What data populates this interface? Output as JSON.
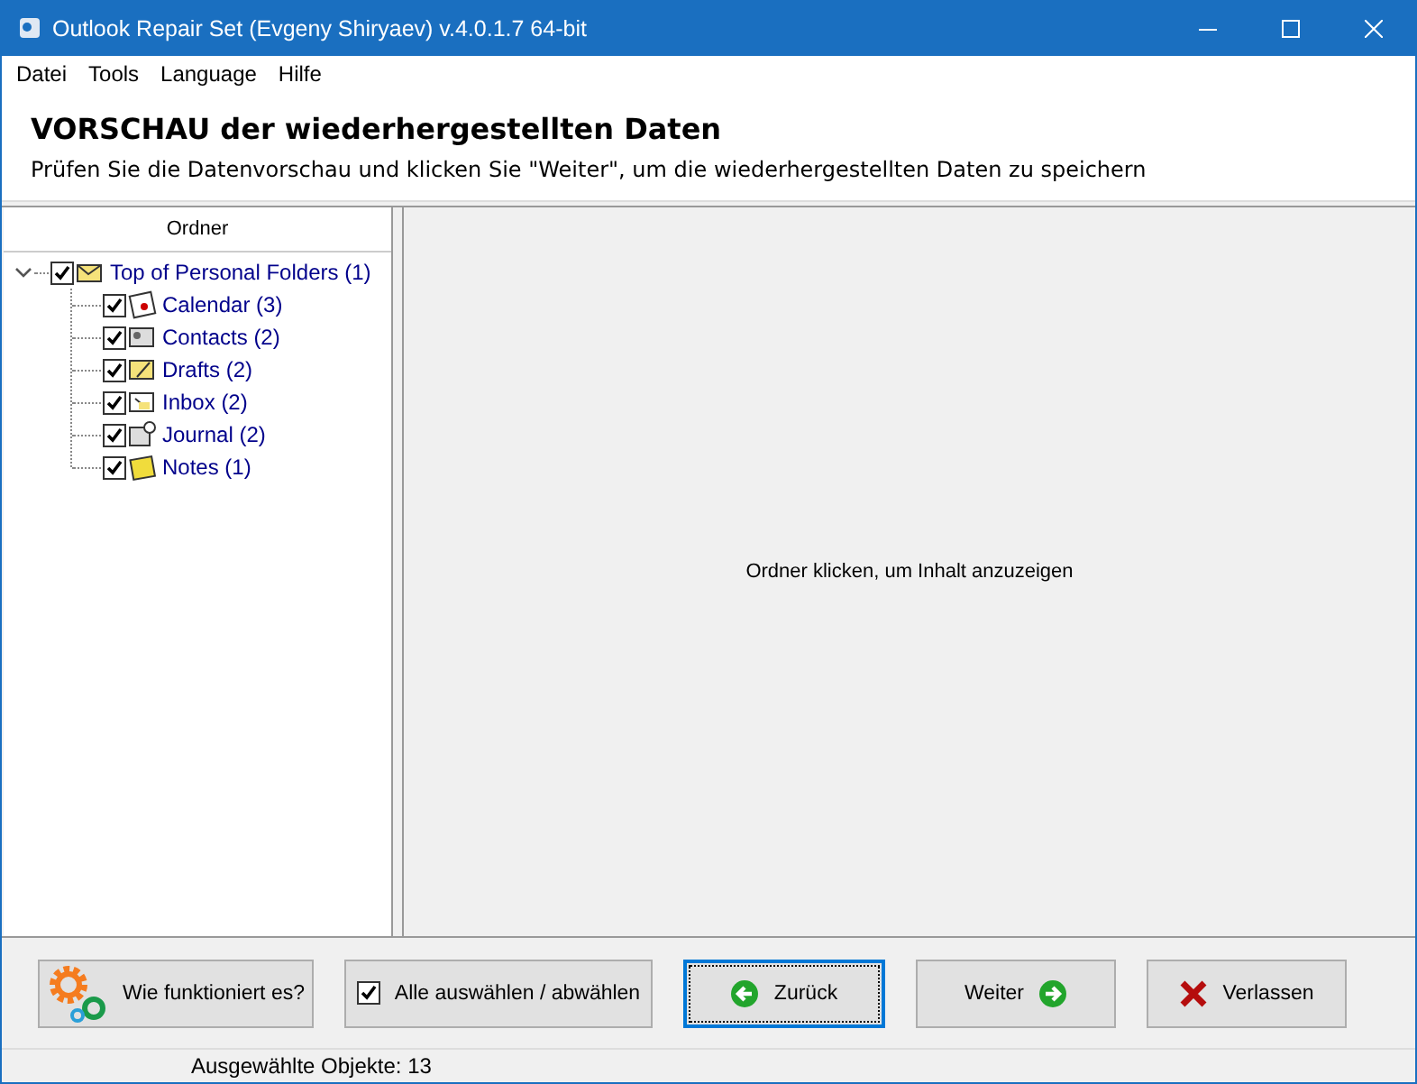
{
  "window": {
    "title": "Outlook Repair Set (Evgeny Shiryaev) v.4.0.1.7 64-bit"
  },
  "menu": [
    "Datei",
    "Tools",
    "Language",
    "Hilfe"
  ],
  "header": {
    "title": "VORSCHAU der wiederhergestellten Daten",
    "subtitle": "Prüfen Sie die Datenvorschau und klicken Sie \"Weiter\", um die wiederhergestellten Daten zu speichern"
  },
  "folder_panel": {
    "heading": "Ordner",
    "tree": [
      {
        "label": "Top of Personal Folders (1)",
        "checked": true,
        "expanded": true,
        "kind": "root",
        "children": [
          {
            "label": "Calendar (3)",
            "checked": true,
            "kind": "calendar"
          },
          {
            "label": "Contacts (2)",
            "checked": true,
            "kind": "contacts"
          },
          {
            "label": "Drafts (2)",
            "checked": true,
            "kind": "drafts"
          },
          {
            "label": "Inbox (2)",
            "checked": true,
            "kind": "inbox"
          },
          {
            "label": "Journal (2)",
            "checked": true,
            "kind": "journal"
          },
          {
            "label": "Notes (1)",
            "checked": true,
            "kind": "notes"
          }
        ]
      }
    ]
  },
  "preview": {
    "message": "Ordner klicken, um Inhalt anzuzeigen"
  },
  "buttons": [
    {
      "kind": "help",
      "label": "Wie funktioniert es?",
      "selected": false
    },
    {
      "kind": "checkbox",
      "label": "Alle auswählen / abwählen",
      "checked": true,
      "selected": false
    },
    {
      "kind": "back",
      "label": "Zurück",
      "selected": true
    },
    {
      "kind": "next",
      "label": "Weiter",
      "selected": false
    },
    {
      "kind": "exit",
      "label": "Verlassen",
      "selected": false
    }
  ],
  "status_bar": {
    "text": "Ausgewählte Objekte: 13"
  }
}
